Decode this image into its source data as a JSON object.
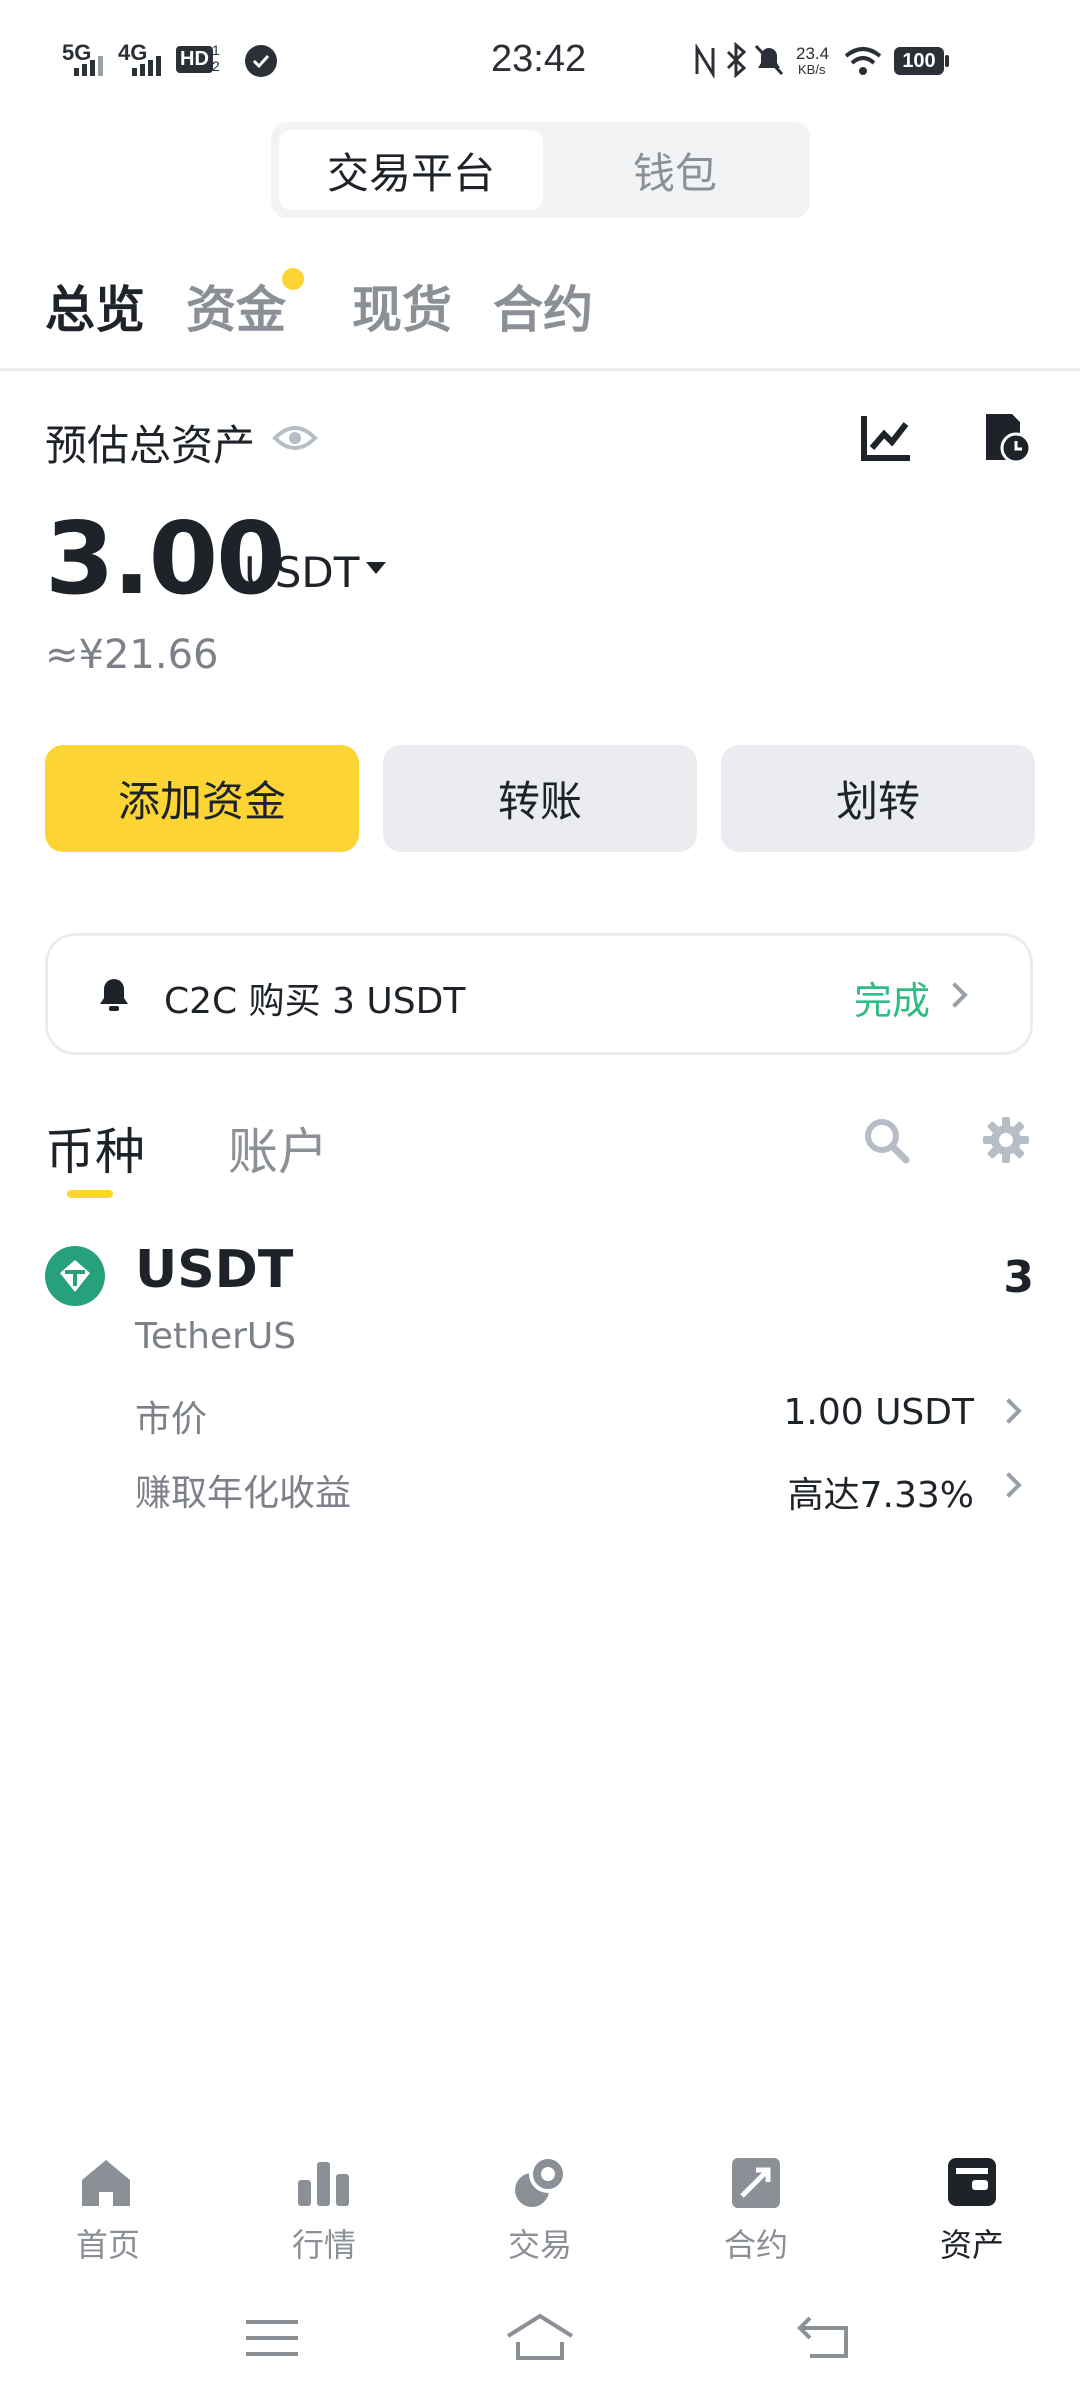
{
  "status_bar": {
    "left_net1": "5G",
    "left_net2": "4G",
    "hd_badge": "HD",
    "hd_sub": "1\n2",
    "time": "23:42",
    "speed_top": "23.4",
    "speed_bottom": "KB/s",
    "battery": "100"
  },
  "top_switch": {
    "active": "交易平台",
    "inactive": "钱包"
  },
  "tabs": [
    {
      "label": "总览",
      "active": true
    },
    {
      "label": "资金",
      "active": false,
      "dot": true
    },
    {
      "label": "现货",
      "active": false
    },
    {
      "label": "合约",
      "active": false
    }
  ],
  "balance": {
    "label": "预估总资产",
    "amount": "3.00",
    "unit": "USDT",
    "approx": "≈¥21.66"
  },
  "actions": {
    "add": "添加资金",
    "transfer": "转账",
    "move": "划转"
  },
  "notice": {
    "text": "C2C 购买 3 USDT",
    "status": "完成"
  },
  "asset_tabs": {
    "coin": "币种",
    "account": "账户"
  },
  "asset": {
    "symbol": "USDT",
    "name": "TetherUS",
    "amount": "3",
    "price_label": "市价",
    "price_value": "1.00 USDT",
    "earn_label": "赚取年化收益",
    "earn_value": "高达7.33%"
  },
  "bottom_nav": [
    {
      "label": "首页",
      "icon": "home-icon"
    },
    {
      "label": "行情",
      "icon": "market-icon"
    },
    {
      "label": "交易",
      "icon": "trade-icon"
    },
    {
      "label": "合约",
      "icon": "futures-icon"
    },
    {
      "label": "资产",
      "icon": "wallet-icon",
      "active": true
    }
  ],
  "colors": {
    "accent": "#fcd535",
    "success": "#2ebd85",
    "text": "#1e2329",
    "muted": "#8b8f96"
  }
}
